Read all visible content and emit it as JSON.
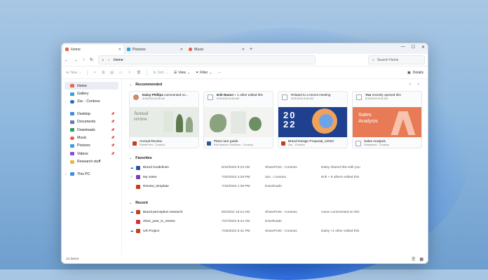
{
  "colors": {
    "accent": "#1a6ed8",
    "word": "#2b579a",
    "powerpoint": "#c43e1c",
    "onedrive": "#1b6ac9",
    "folder": "#e9b740"
  },
  "tabs": [
    {
      "label": "Home",
      "icon": "home-icon",
      "color": "#e06c55"
    },
    {
      "label": "Pictures",
      "icon": "pictures-folder-icon",
      "color": "#3aa0d8"
    },
    {
      "label": "Music",
      "icon": "music-folder-icon",
      "color": "#e9573f"
    }
  ],
  "nav": {
    "address": "Home",
    "search_placeholder": "Search Home"
  },
  "toolbar": {
    "new_label": "New",
    "sort_label": "Sort",
    "view_label": "View",
    "filter_label": "Filter",
    "more_label": "···",
    "details_label": "Details"
  },
  "sidebar": {
    "items": [
      {
        "label": "Home",
        "icon": "home-icon",
        "color": "#e06c55"
      },
      {
        "label": "Gallery",
        "icon": "gallery-icon",
        "color": "#3aa0d8"
      },
      {
        "label": "Zac - Contoso",
        "icon": "onedrive-cloud-icon",
        "color": "#1b6ac9"
      },
      {
        "label": "Desktop",
        "icon": "desktop-icon",
        "color": "#3a8fd8"
      },
      {
        "label": "Documents",
        "icon": "documents-icon",
        "color": "#5a7fa8"
      },
      {
        "label": "Downloads",
        "icon": "downloads-icon",
        "color": "#2d9a5f"
      },
      {
        "label": "Music",
        "icon": "music-icon",
        "color": "#e9573f"
      },
      {
        "label": "Pictures",
        "icon": "pictures-icon",
        "color": "#3aa0d8"
      },
      {
        "label": "Videos",
        "icon": "videos-icon",
        "color": "#8a4fc9"
      },
      {
        "label": "Research stuff",
        "icon": "folder-icon",
        "color": "#e9b740"
      },
      {
        "label": "This PC",
        "icon": "this-pc-icon",
        "color": "#3a8fd8"
      }
    ]
  },
  "recommended": {
    "title": "Recommended",
    "cards": [
      {
        "who": "Daisy Phillips",
        "activity": "commented on...",
        "date": "5/15/2023 8:45 AM",
        "title": "Annual Review",
        "source": "SharePoint - Contoso",
        "thumb_text": "Annual review"
      },
      {
        "who": "Erik Nason",
        "activity": "+ 1 other edited this",
        "date": "5/15/2023 8:45 AM",
        "title": "Plant care guide",
        "source": "Erik Nason's OneDrive - Contoso",
        "thumb_text": ""
      },
      {
        "who": "",
        "activity": "Related to a recent meeting",
        "date": "5/15/2023 8:45 AM",
        "title": "Brand Design Proposal_v2022",
        "source": "Zac - Contoso",
        "thumb_text": "2022"
      },
      {
        "who": "You",
        "activity": "recently opened this",
        "date": "5/15/2023 8:45 AM",
        "title": "Sales Analysis",
        "source": "Sharepoint - Contoso",
        "thumb_text": "Sales Analysis"
      }
    ]
  },
  "favorites": {
    "title": "Favorites",
    "rows": [
      {
        "status": "cloud-icon",
        "name": "Brand Guidelines",
        "date": "8/10/2022 9:23 AM",
        "location": "SharePoint - Contoso",
        "activity": "Daisy shared this with you"
      },
      {
        "status": "synced-check-icon",
        "name": "My notes",
        "date": "7/20/2022 4:29 PM",
        "location": "Zac - Contoso",
        "activity": "Erik + 9 others edited this"
      },
      {
        "status": "",
        "name": "Review_template",
        "date": "7/15/2022 1:38 PM",
        "location": "Downloads",
        "activity": ""
      }
    ]
  },
  "recent": {
    "title": "Recent",
    "rows": [
      {
        "status": "cloud-icon",
        "name": "Brand perception research",
        "date": "8/2/2022 10:24 AM",
        "location": "SharePoint - Contoso",
        "activity": "Aaron commented on this"
      },
      {
        "status": "",
        "name": "2022_year_in_review",
        "date": "7/27/2022 8:44 AM",
        "location": "Downloads",
        "activity": ""
      },
      {
        "status": "cloud-icon",
        "name": "UR Project",
        "date": "7/25/2022 5:41 PM",
        "location": "SharePoint - Contoso",
        "activity": "Daisy +1 other edited this"
      }
    ]
  },
  "status": {
    "items": "14 items"
  }
}
